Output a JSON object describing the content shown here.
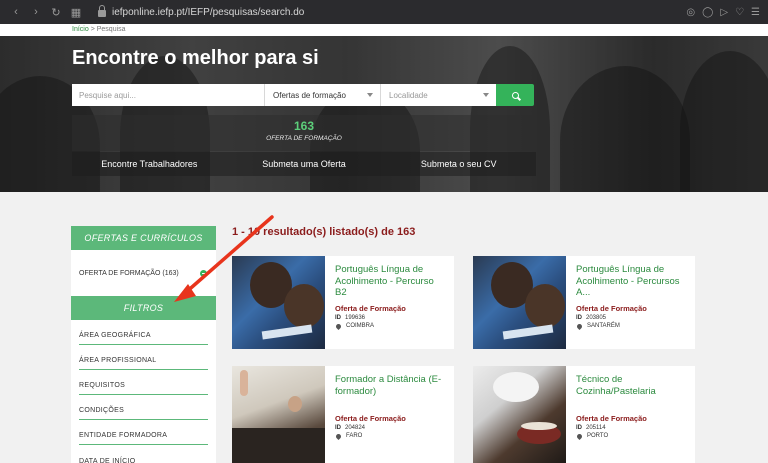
{
  "browser": {
    "url": "iefponline.iefp.pt/IEFP/pesquisas/search.do"
  },
  "breadcrumb": {
    "home": "Início",
    "separator": ">",
    "current": "Pesquisa"
  },
  "hero": {
    "title": "Encontre o melhor para si",
    "search_placeholder": "Pesquise aqui...",
    "offer_select": "Ofertas de formação",
    "location_select": "Localidade",
    "count": "163",
    "count_label": "OFERTA DE FORMAÇÃO",
    "actions": [
      "Encontre Trabalhadores",
      "Submeta uma Oferta",
      "Submeta o seu CV"
    ]
  },
  "sidebar": {
    "section1_title": "OFERTAS E CURRÍCULOS",
    "section1_item": "OFERTA DE FORMAÇÃO (163)",
    "filters_title": "FILTROS",
    "filters": [
      "ÁREA GEOGRÁFICA",
      "ÁREA PROFISSIONAL",
      "REQUISITOS",
      "CONDIÇÕES",
      "ENTIDADE FORMADORA",
      "DATA DE INÍCIO"
    ]
  },
  "results": {
    "summary": "1 - 10 resultado(s) listado(s) de 163",
    "cards": [
      {
        "title": "Português Língua de Acolhimento - Percurso B2",
        "type": "Oferta de Formação",
        "id_label": "ID",
        "id": "199636",
        "location": "COIMBRA"
      },
      {
        "title": "Português Língua de Acolhimento - Percursos A...",
        "type": "Oferta de Formação",
        "id_label": "ID",
        "id": "203805",
        "location": "SANTARÉM"
      },
      {
        "title": "Formador a Distância (E-formador)",
        "type": "Oferta de Formação",
        "id_label": "ID",
        "id": "204824",
        "location": "FARO"
      },
      {
        "title": "Técnico de Cozinha/Pastelaria",
        "type": "Oferta de Formação",
        "id_label": "ID",
        "id": "205114",
        "location": "PORTO"
      }
    ]
  },
  "colors": {
    "accent_green": "#5cb87a",
    "button_green": "#34b35a",
    "title_red": "#8b1c1c",
    "annotation_red": "#e8341c"
  }
}
